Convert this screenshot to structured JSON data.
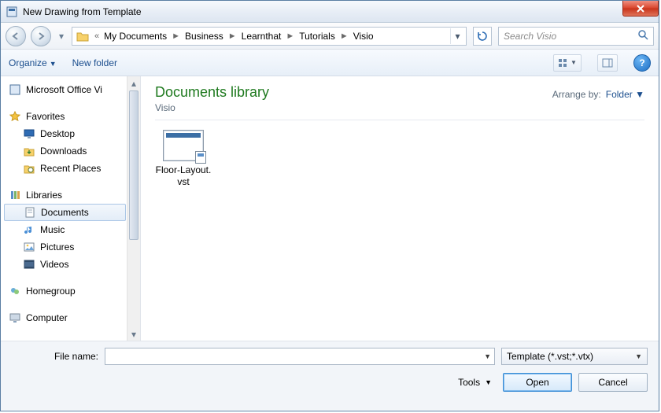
{
  "window": {
    "title": "New Drawing from Template"
  },
  "breadcrumb": {
    "prefix": "«",
    "items": [
      "My Documents",
      "Business",
      "Learnthat",
      "Tutorials",
      "Visio"
    ]
  },
  "search": {
    "placeholder": "Search Visio"
  },
  "toolbar": {
    "organize": "Organize",
    "newfolder": "New folder"
  },
  "sidebar": {
    "office": "Microsoft Office Vi",
    "favorites": {
      "label": "Favorites",
      "items": [
        "Desktop",
        "Downloads",
        "Recent Places"
      ]
    },
    "libraries": {
      "label": "Libraries",
      "items": [
        "Documents",
        "Music",
        "Pictures",
        "Videos"
      ]
    },
    "homegroup": "Homegroup",
    "computer": "Computer"
  },
  "main": {
    "lib_title": "Documents library",
    "lib_sub": "Visio",
    "arrange_label": "Arrange by:",
    "arrange_value": "Folder",
    "file_name": "Floor-Layout.vst"
  },
  "footer": {
    "filename_label": "File name:",
    "filename_value": "",
    "filter": "Template (*.vst;*.vtx)",
    "tools": "Tools",
    "open": "Open",
    "cancel": "Cancel"
  }
}
